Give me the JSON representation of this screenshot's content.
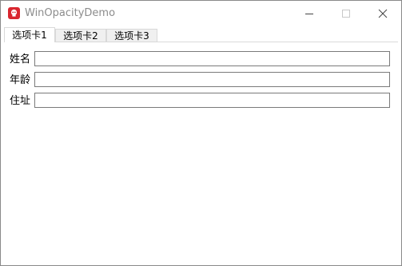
{
  "window": {
    "title": "WinOpacityDemo",
    "accent": "#d9262f",
    "controls": {
      "minimize": "minimize-icon",
      "maximize": "maximize-icon",
      "close": "close-icon"
    }
  },
  "tabs": [
    {
      "label": "选项卡1",
      "active": true
    },
    {
      "label": "选项卡2",
      "active": false
    },
    {
      "label": "选项卡3",
      "active": false
    }
  ],
  "form": {
    "fields": [
      {
        "label": "姓名",
        "value": ""
      },
      {
        "label": "年龄",
        "value": ""
      },
      {
        "label": "住址",
        "value": ""
      }
    ]
  }
}
